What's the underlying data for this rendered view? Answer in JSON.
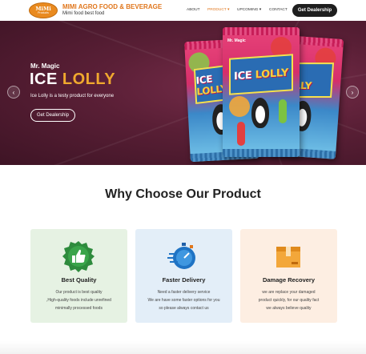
{
  "header": {
    "logo_line1": "MiMi",
    "logo_line2": "Products",
    "brand_title": "MIMI AGRO FOOD & BEVERAGE",
    "brand_subtitle": "Mimi food best food",
    "nav": [
      {
        "label": "ABOUT"
      },
      {
        "label": "PRODUCT ▾"
      },
      {
        "label": "UPCOMING ▾"
      },
      {
        "label": "CONTACT"
      }
    ],
    "cta": "Get Dealership"
  },
  "hero": {
    "subtitle": "Mr. Magic",
    "title_part1": "ICE ",
    "title_part2": "LOLLY",
    "description": "Ice Lolly is a testy product for everyone",
    "button": "Get Dealership",
    "prev": "‹",
    "next": "›",
    "pack_brand": "Mr. Magic",
    "pack_label1": "ICE ",
    "pack_label2": "LOLLY"
  },
  "section": {
    "title": "Why Choose Our Product",
    "cards": [
      {
        "title": "Best Quality",
        "lines": [
          "Our product is best quality",
          ",High-quality foods include unrefined",
          "minimally processed foods"
        ],
        "bg": "#e6f2e3",
        "icon": "thumbs-up-badge-icon"
      },
      {
        "title": "Faster Delivery",
        "lines": [
          "Need a faster delivery service",
          "We are have some faster options for you",
          "so please always contact us"
        ],
        "bg": "#e3eef8",
        "icon": "stopwatch-icon"
      },
      {
        "title": "Damage Recovery",
        "lines": [
          "we are replace your damaged",
          "product quickly, for our quality fact",
          "we always believe quality"
        ],
        "bg": "#fdeee2",
        "icon": "box-icon"
      }
    ]
  },
  "colors": {
    "accent": "#e0761c",
    "hero_bg": "#5a1f36",
    "lolly_yellow": "#f0a92e",
    "dark_button": "#1e1e1e"
  }
}
